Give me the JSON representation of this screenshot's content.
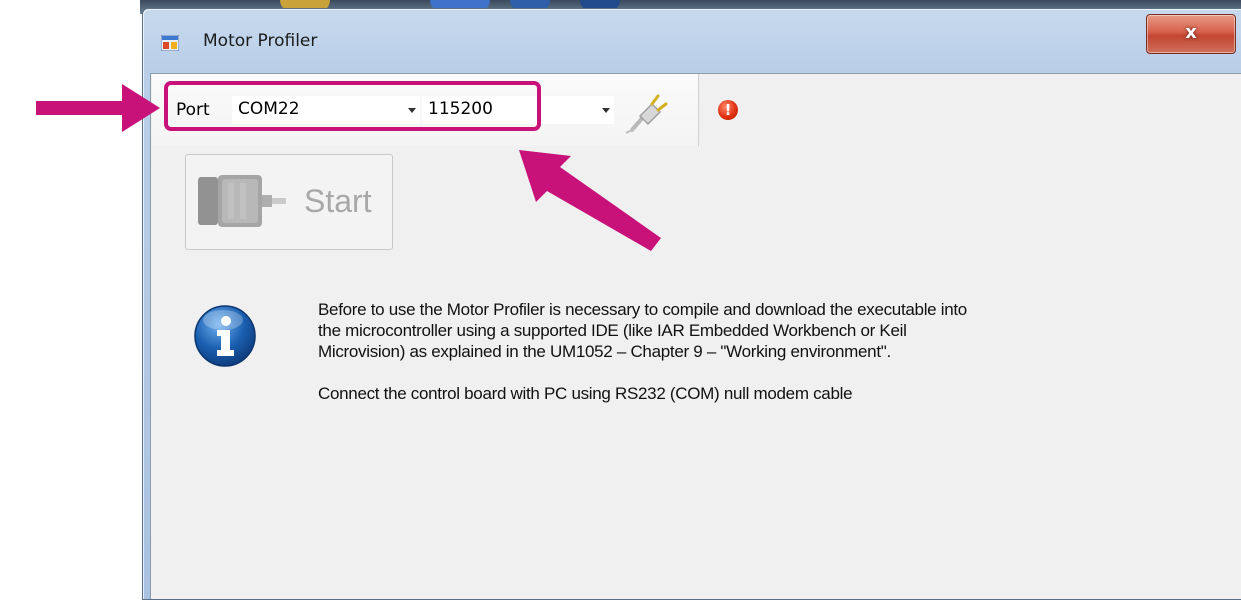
{
  "window": {
    "title": "Motor Profiler",
    "close_glyph": "x"
  },
  "toolbar": {
    "port_label": "Port",
    "port_value": "COM22",
    "baud_value": "115200",
    "connect_icon": "plug-icon",
    "status_icon": "error-icon",
    "status_glyph": "!"
  },
  "start_button": {
    "label": "Start",
    "icon": "motor-icon"
  },
  "info": {
    "icon": "info-icon",
    "paragraph1_lines": [
      "Before to use the Motor Profiler is necessary to compile and download the executable into",
      "the microcontroller using a supported IDE (like IAR Embedded Workbench or Keil",
      "Microvision) as explained in the UM1052 – Chapter 9 – \"Working environment\"."
    ],
    "paragraph2": "Connect the control board with PC using RS232 (COM) null modem cable"
  },
  "colors": {
    "annotation": "#c8127a",
    "error": "#e03010",
    "info_blue": "#1a5fb0"
  }
}
